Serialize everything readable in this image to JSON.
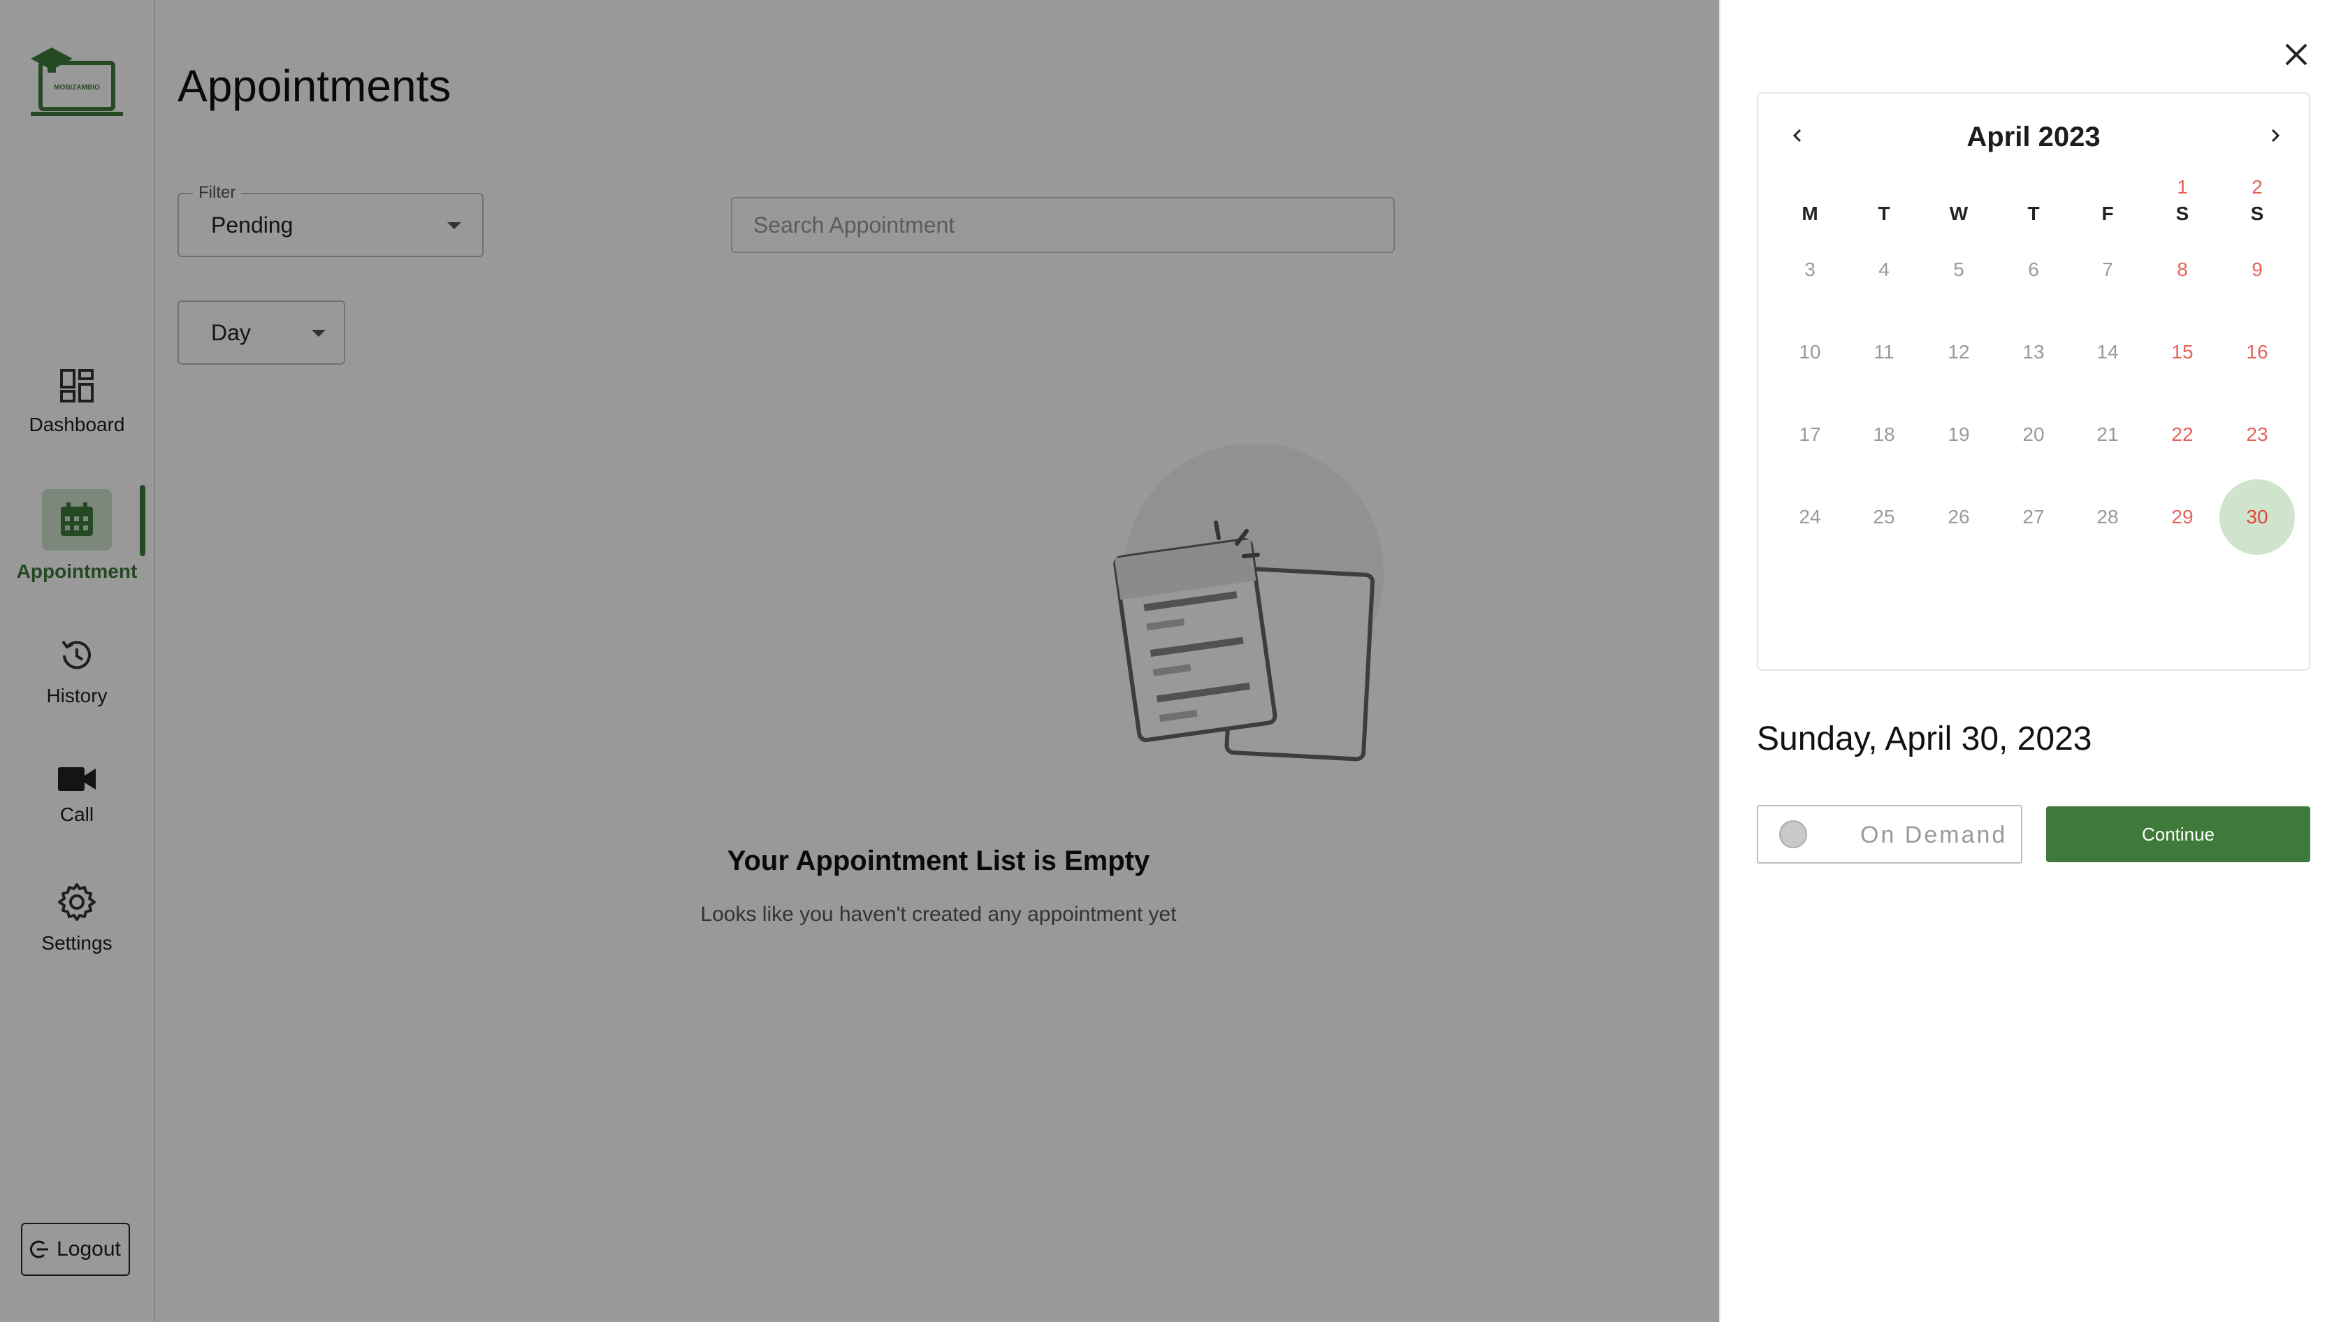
{
  "sidebar": {
    "logo_text": "MOBIZAMBIO",
    "items": [
      {
        "label": "Dashboard",
        "icon": "dashboard-icon"
      },
      {
        "label": "Appointment",
        "icon": "calendar-icon",
        "active": true
      },
      {
        "label": "History",
        "icon": "history-icon"
      },
      {
        "label": "Call",
        "icon": "video-icon"
      },
      {
        "label": "Settings",
        "icon": "gear-icon"
      }
    ],
    "logout_label": "Logout"
  },
  "main": {
    "title": "Appointments",
    "filter": {
      "legend": "Filter",
      "value": "Pending"
    },
    "search": {
      "placeholder": "Search Appointment",
      "value": ""
    },
    "period": {
      "value": "Day"
    },
    "empty": {
      "title": "Your Appointment List is Empty",
      "subtitle": "Looks like you haven't created any appointment yet"
    }
  },
  "drawer": {
    "calendar": {
      "month_label": "April 2023",
      "prev_icon": "chevron-left-icon",
      "next_icon": "chevron-right-icon",
      "weekdays": [
        "M",
        "T",
        "W",
        "T",
        "F",
        "S",
        "S"
      ],
      "weeks": [
        [
          "",
          "",
          "",
          "",
          "",
          "1",
          "2"
        ],
        [
          "3",
          "4",
          "5",
          "6",
          "7",
          "8",
          "9"
        ],
        [
          "10",
          "11",
          "12",
          "13",
          "14",
          "15",
          "16"
        ],
        [
          "17",
          "18",
          "19",
          "20",
          "21",
          "22",
          "23"
        ],
        [
          "24",
          "25",
          "26",
          "27",
          "28",
          "29",
          "30"
        ]
      ],
      "selected_day": "30"
    },
    "selected_date": "Sunday, April 30, 2023",
    "on_demand_label": "On Demand",
    "continue_label": "Continue"
  },
  "colors": {
    "accent": "#3f7a3a",
    "accent_light": "#cfe3cd",
    "weekend": "#e4635a",
    "overlay": "rgba(0,0,0,0.40)"
  }
}
